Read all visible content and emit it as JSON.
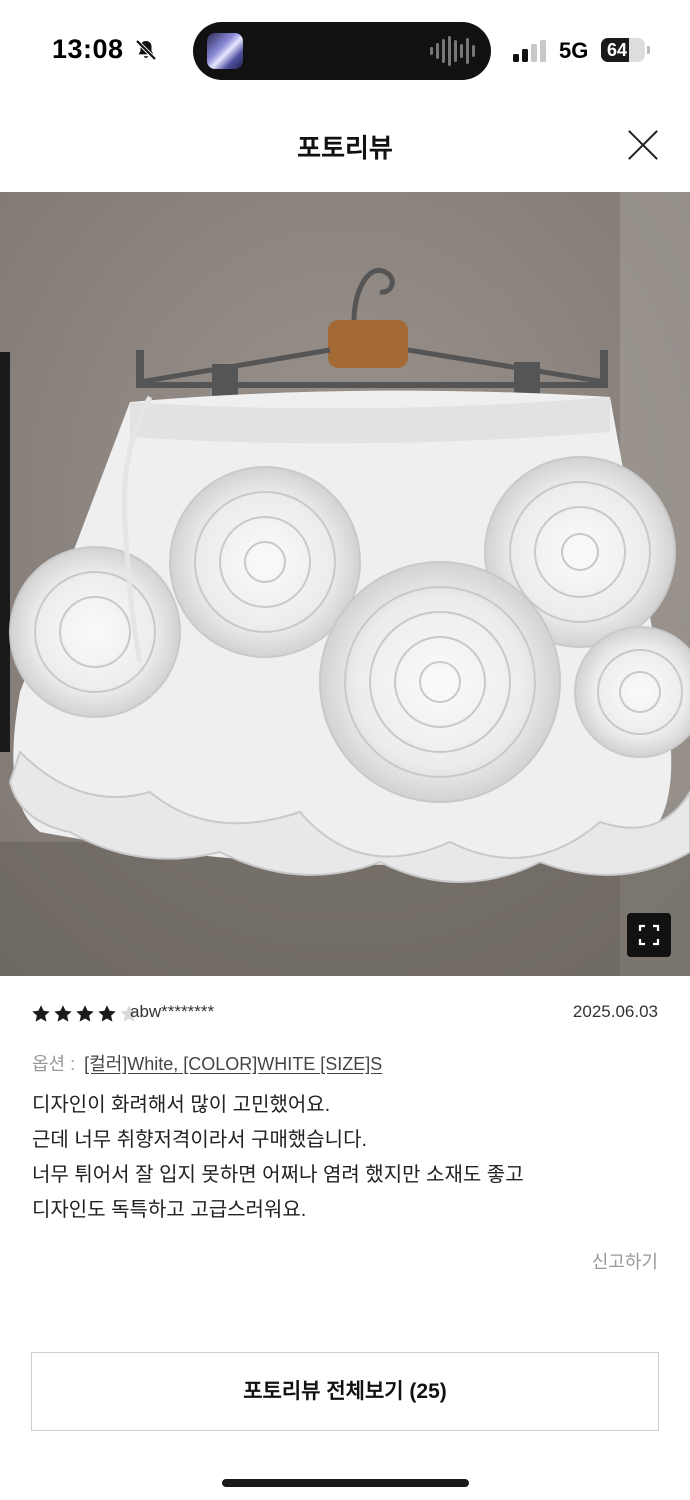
{
  "status_bar": {
    "time": "13:08",
    "network": "5G",
    "battery_level": "64",
    "battery_fraction": 0.64,
    "icons": [
      "bell-slash-icon",
      "signal-icon",
      "battery-icon"
    ]
  },
  "header": {
    "title": "포토리뷰",
    "close_icon": "close-icon"
  },
  "photo": {
    "subject": "photo-white-ruffled-rose-skirt",
    "expand_icon": "expand-icon"
  },
  "review": {
    "rating": 4,
    "rating_max": 5,
    "author": "abw********",
    "date": "2025.06.03",
    "option_label": "옵션 :",
    "option_value": "[컬러]White, [COLOR]WHITE [SIZE]S",
    "lines": [
      "디자인이 화려해서 많이 고민했어요.",
      "근데 너무 취향저격이라서 구매했습니다.",
      "너무 튀어서 잘 입지 못하면 어쩌나 염려 했지만 소재도 좋고",
      "디자인도 독특하고 고급스러워요."
    ],
    "report_label": "신고하기"
  },
  "footer": {
    "view_all_label": "포토리뷰 전체보기 (25)"
  },
  "colors": {
    "star_filled": "#1a1a1a",
    "star_empty": "#d9d9d9",
    "text_primary": "#111111",
    "text_muted": "#999999"
  }
}
